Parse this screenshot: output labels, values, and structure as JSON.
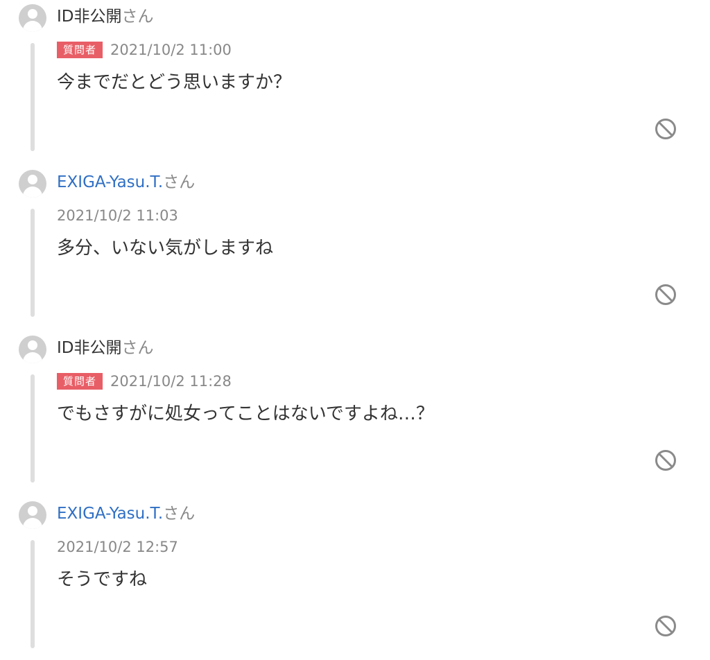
{
  "thread": {
    "comments": [
      {
        "author": "ID非公開",
        "suffix": "さん",
        "badge": "質問者",
        "timestamp": "2021/10/2 11:00",
        "text": "今までだとどう思いますか？"
      },
      {
        "author": "EXIGA-Yasu.T.",
        "suffix": "さん",
        "timestamp": "2021/10/2 11:03",
        "text": "多分、いない気がしますね"
      },
      {
        "author": "ID非公開",
        "suffix": "さん",
        "badge": "質問者",
        "timestamp": "2021/10/2 11:28",
        "text": "でもさすがに処女ってことはないですよね…？"
      },
      {
        "author": "EXIGA-Yasu.T.",
        "suffix": "さん",
        "timestamp": "2021/10/2 12:57",
        "text": "そうですね"
      }
    ]
  },
  "colors": {
    "badge": "#e85e66",
    "link": "#2f6fc4",
    "muted": "#888888",
    "thread_line": "#dedede"
  },
  "icons": {
    "avatar": "default-user-avatar-icon",
    "report": "prohibited-circle-icon"
  }
}
